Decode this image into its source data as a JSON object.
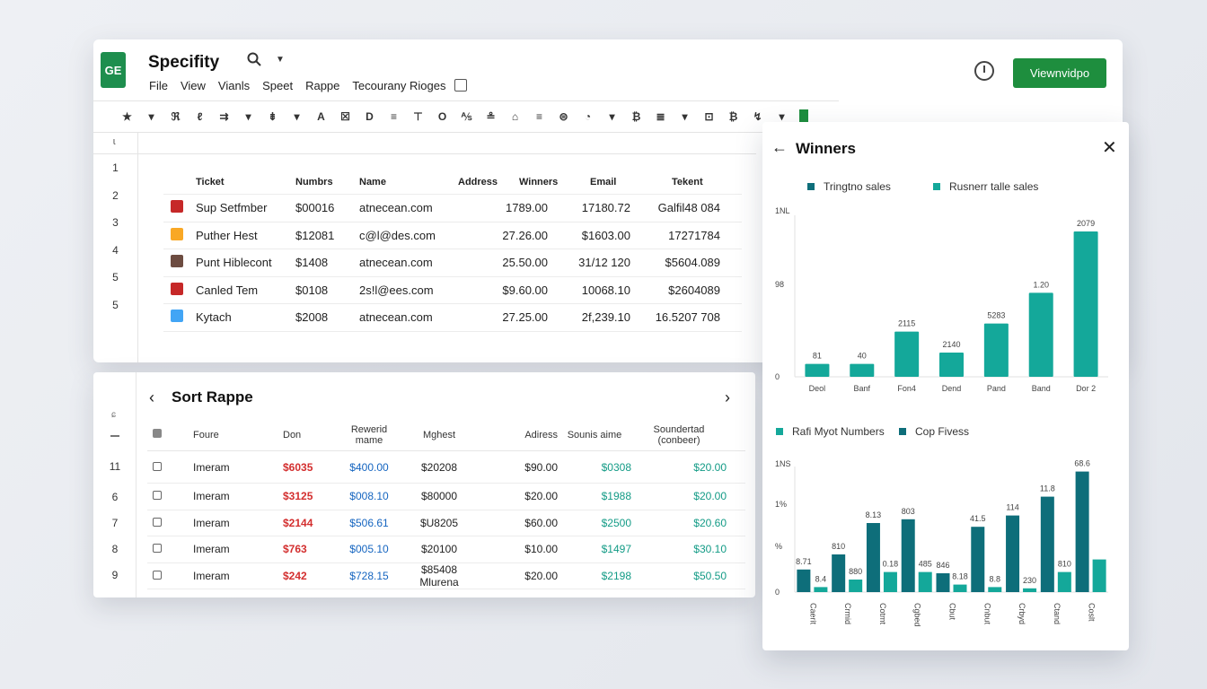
{
  "app": {
    "title": "Specifity",
    "logo_text": "GE",
    "menu": [
      "File",
      "View",
      "Vianls",
      "Speet",
      "Rappe",
      "Tecourany Rioges"
    ],
    "cta_label": "Viewnvidpo"
  },
  "toolbar": {
    "items": [
      "★",
      "▾",
      "ℜ",
      "ℓ",
      "⇉",
      "▾",
      "⇟",
      "▾",
      "A",
      "☒",
      "D",
      "≡",
      "⊤",
      "O",
      "⅍",
      "≗",
      "⌂",
      "≡",
      "⊜",
      "◔",
      "▾",
      "₿",
      "≣",
      "▾",
      "⊡",
      "₿",
      "↯",
      "▾"
    ]
  },
  "sheet": {
    "formula_glyph": "ɩ",
    "row_numbers": [
      "1",
      "2",
      "3",
      "4",
      "5",
      "5"
    ],
    "headers": [
      "Ticket",
      "Numbrs",
      "Name",
      "Address",
      "Winners",
      "Email",
      "Tekent"
    ],
    "rows": [
      {
        "icon_color": "#c62828",
        "ticket": "Sup Setfmber",
        "number": "$00016",
        "name": "atnecean.com",
        "winners": "1789.00",
        "email": "17180.72",
        "tekent": "Galfil48 084"
      },
      {
        "icon_color": "#f9a825",
        "ticket": "Puther Hest",
        "number": "$12081",
        "name": "c@l@des.com",
        "winners": "27.26.00",
        "email": "$1603.00",
        "tekent": "17271784"
      },
      {
        "icon_color": "#6d4c41",
        "ticket": "Punt Hiblecont",
        "number": "$1408",
        "name": "atnecean.com",
        "winners": "25.50.00",
        "email": "31/12 120",
        "tekent": "$5604.089"
      },
      {
        "icon_color": "#c62828",
        "ticket": "Canled Tem",
        "number": "$0108",
        "name": "2s!l@ees.com",
        "winners": "$9.60.00",
        "email": "10068.10",
        "tekent": "$2604089"
      },
      {
        "icon_color": "#42a5f5",
        "ticket": "Kytach",
        "number": "$2008",
        "name": "atnecean.com",
        "winners": "27.25.00",
        "email": "2f,239.10",
        "tekent": "16.5207 708"
      }
    ]
  },
  "sort_panel": {
    "title": "Sort Rappe",
    "side_glyph": "ɕ",
    "headers": [
      "Foure",
      "Don",
      "Rewerid mame",
      "Mghest",
      "Adiress",
      "Sounis aime",
      "Soundertad (conbeer)"
    ],
    "row_numbers": [
      "11",
      "6",
      "7",
      "8",
      "9"
    ],
    "rows": [
      {
        "foure": "Imeram",
        "don": "$6035",
        "rewerid": "$400.00",
        "mghest": "$20208",
        "adiress": "$90.00",
        "sounis": "$0308",
        "sounder": "$20.00"
      },
      {
        "foure": "Imeram",
        "don": "$3125",
        "rewerid": "$008.10",
        "mghest": "$80000",
        "adiress": "$20.00",
        "sounis": "$1988",
        "sounder": "$20.00"
      },
      {
        "foure": "Imeram",
        "don": "$2144",
        "rewerid": "$506.61",
        "mghest": "$U8205",
        "adiress": "$60.00",
        "sounis": "$2500",
        "sounder": "$20.60"
      },
      {
        "foure": "Imeram",
        "don": "$763",
        "rewerid": "$005.10",
        "mghest": "$20100",
        "adiress": "$10.00",
        "sounis": "$1497",
        "sounder": "$30.10"
      },
      {
        "foure": "Imeram",
        "don": "$242",
        "rewerid": "$728.15",
        "mghest": "$85408 Mlurena",
        "adiress": "$20.00",
        "sounis": "$2198",
        "sounder": "$50.50"
      }
    ]
  },
  "winners_panel": {
    "title": "Winners"
  },
  "chart_data": [
    {
      "type": "bar",
      "series": [
        {
          "name": "Tringtno sales",
          "color": "#0e6e7a"
        },
        {
          "name": "Rusnerr talle sales",
          "color": "#14a89a"
        }
      ],
      "categories": [
        "Deol",
        "Banf",
        "Fon4",
        "Dend",
        "Pand",
        "Band",
        "Dor 2"
      ],
      "values": [
        8,
        8,
        28,
        15,
        33,
        52,
        90
      ],
      "data_labels": [
        "81",
        "40",
        "2115",
        "2140",
        "5283",
        "1.20",
        "2079"
      ],
      "y_ticks": [
        "1NL",
        "98",
        "0"
      ],
      "ylim": [
        0,
        100
      ]
    },
    {
      "type": "bar",
      "series": [
        {
          "name": "Rafi Myot Numbers",
          "color": "#14a89a"
        },
        {
          "name": "Cop Fivess",
          "color": "#0e6e7a"
        }
      ],
      "categories": [
        "Caerit",
        "Crmid",
        "Cotmt",
        "Cgbed",
        "Cbut",
        "Cnbut",
        "Crbyd",
        "Ctand",
        "Coslt"
      ],
      "series_values": [
        [
          18,
          30,
          55,
          58,
          15,
          52,
          61,
          76,
          96
        ],
        [
          4,
          10,
          16,
          16,
          6,
          4,
          3,
          16,
          26
        ]
      ],
      "data_labels_primary": [
        "8.71",
        "810",
        "8.13",
        "803",
        "846",
        "41.5",
        "114",
        "11.8",
        "68.6"
      ],
      "data_labels_secondary": [
        "8.4",
        "880",
        "0.18",
        "485",
        "8.18",
        "8.8",
        "230",
        "810",
        ""
      ],
      "y_ticks": [
        "1NS",
        "1%",
        "%",
        "0"
      ],
      "ylim": [
        0,
        100
      ]
    }
  ]
}
